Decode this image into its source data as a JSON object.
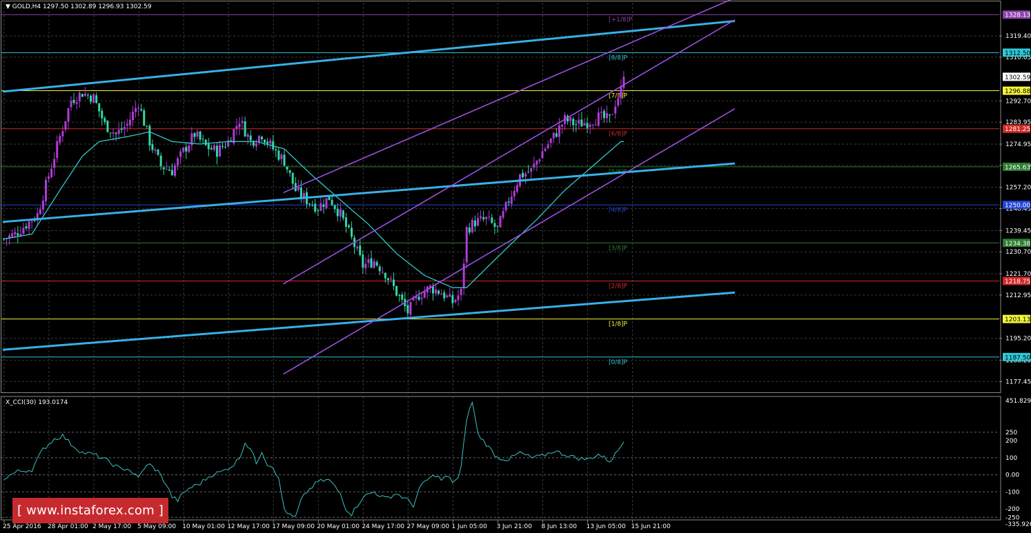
{
  "header": {
    "symbol": "GOLD,H4",
    "ohlc": "1297.50 1302.89 1296.93 1302.59",
    "indicator": "X_CCI(30) 193.0174"
  },
  "watermark": {
    "text": "[ www.instaforex.com ]"
  },
  "colors": {
    "bull": "#b13bd9",
    "bear": "#35d7a7",
    "ma": "#35c7c9",
    "channel": "#37b1e8",
    "purple": "#9b4fe0",
    "cci": "#3bc3c3"
  },
  "chart_data": [
    {
      "type": "line",
      "panel": "price",
      "ylim": [
        1173,
        1333
      ],
      "y_ticks": [
        "1319.40",
        "1310.65",
        "1292.70",
        "1283.95",
        "1274.95",
        "1266.20",
        "1257.20",
        "1248.45",
        "1239.45",
        "1230.70",
        "1221.70",
        "1212.95",
        "1195.20",
        "1186.20",
        "1177.45"
      ],
      "x_ticks": [
        "25 Apr 2016",
        "28 Apr 01:00",
        "2 May 17:00",
        "5 May 09:00",
        "10 May 01:00",
        "12 May 17:00",
        "17 May 09:00",
        "20 May 01:00",
        "24 May 17:00",
        "27 May 09:00",
        "1 Jun 05:00",
        "3 Jun 21:00",
        "8 Jun 13:00",
        "13 Jun 05:00",
        "15 Jun 21:00"
      ],
      "x_tick_bars": [
        0,
        16,
        32,
        48,
        64,
        80,
        96,
        112,
        128,
        144,
        160,
        176,
        192,
        208,
        224
      ],
      "price_labels": [
        {
          "text": "1328.13",
          "value": 1328.13,
          "bg": "#8e44ad",
          "fg": "#ffffff"
        },
        {
          "text": "1312.50",
          "value": 1312.5,
          "bg": "#2ec9d6",
          "fg": "#000000"
        },
        {
          "text": "1302.59",
          "value": 1302.59,
          "bg": "#ffffff",
          "fg": "#000000"
        },
        {
          "text": "1296.88",
          "value": 1296.88,
          "bg": "#f5f53a",
          "fg": "#000000"
        },
        {
          "text": "1281.25",
          "value": 1281.25,
          "bg": "#d12a2a",
          "fg": "#ffffff"
        },
        {
          "text": "1265.63",
          "value": 1265.63,
          "bg": "#2e7d32",
          "fg": "#ffffff"
        },
        {
          "text": "1250.00",
          "value": 1250.0,
          "bg": "#2446d8",
          "fg": "#ffffff"
        },
        {
          "text": "1234.38",
          "value": 1234.38,
          "bg": "#2e7d32",
          "fg": "#ffffff"
        },
        {
          "text": "1218.75",
          "value": 1218.75,
          "bg": "#d12a2a",
          "fg": "#ffffff"
        },
        {
          "text": "1203.13",
          "value": 1203.13,
          "bg": "#f5f53a",
          "fg": "#000000"
        },
        {
          "text": "1187.50",
          "value": 1187.5,
          "bg": "#2ec9d6",
          "fg": "#000000"
        }
      ],
      "murrey_levels": [
        {
          "label": "[+1/8]P",
          "value": 1328.13,
          "color": "#8e44ad"
        },
        {
          "label": "[8/8]P",
          "value": 1312.5,
          "color": "#2ec9d6"
        },
        {
          "label": "[7/8]P",
          "value": 1296.88,
          "color": "#f5f53a"
        },
        {
          "label": "[6/8]P",
          "value": 1281.25,
          "color": "#d12a2a"
        },
        {
          "label": "[5/8]P",
          "value": 1265.63,
          "color": "#2e7d32"
        },
        {
          "label": "[4/8]P",
          "value": 1250.0,
          "color": "#2446d8"
        },
        {
          "label": "[3/8]P",
          "value": 1234.38,
          "color": "#2e7d32"
        },
        {
          "label": "[2/8]P",
          "value": 1218.75,
          "color": "#d12a2a"
        },
        {
          "label": "[1/8]P",
          "value": 1203.13,
          "color": "#f5f53a"
        },
        {
          "label": "[0/8]P",
          "value": 1187.5,
          "color": "#2ec9d6"
        }
      ],
      "close_anchors": [
        [
          0,
          1236
        ],
        [
          4,
          1238
        ],
        [
          8,
          1242
        ],
        [
          12,
          1246
        ],
        [
          16,
          1262
        ],
        [
          20,
          1278
        ],
        [
          24,
          1293
        ],
        [
          28,
          1296
        ],
        [
          32,
          1294
        ],
        [
          36,
          1283
        ],
        [
          40,
          1279
        ],
        [
          44,
          1283
        ],
        [
          48,
          1292
        ],
        [
          52,
          1276
        ],
        [
          56,
          1266
        ],
        [
          60,
          1264
        ],
        [
          64,
          1272
        ],
        [
          68,
          1279
        ],
        [
          72,
          1274
        ],
        [
          76,
          1272
        ],
        [
          80,
          1276
        ],
        [
          84,
          1285
        ],
        [
          88,
          1276
        ],
        [
          92,
          1279
        ],
        [
          96,
          1273
        ],
        [
          100,
          1268
        ],
        [
          104,
          1256
        ],
        [
          108,
          1252
        ],
        [
          112,
          1249
        ],
        [
          116,
          1253
        ],
        [
          120,
          1246
        ],
        [
          124,
          1236
        ],
        [
          128,
          1225
        ],
        [
          132,
          1227
        ],
        [
          136,
          1222
        ],
        [
          140,
          1214
        ],
        [
          144,
          1206
        ],
        [
          148,
          1213
        ],
        [
          152,
          1216
        ],
        [
          156,
          1214
        ],
        [
          160,
          1210
        ],
        [
          163,
          1214
        ],
        [
          165,
          1240
        ],
        [
          168,
          1243
        ],
        [
          172,
          1244
        ],
        [
          176,
          1240
        ],
        [
          180,
          1252
        ],
        [
          184,
          1262
        ],
        [
          188,
          1264
        ],
        [
          192,
          1272
        ],
        [
          196,
          1278
        ],
        [
          200,
          1285
        ],
        [
          204,
          1283
        ],
        [
          208,
          1284
        ],
        [
          212,
          1286
        ],
        [
          216,
          1285
        ],
        [
          218,
          1292
        ],
        [
          220,
          1297
        ],
        [
          221,
          1302.6
        ]
      ],
      "ma_anchors": [
        [
          0,
          1236
        ],
        [
          10,
          1238
        ],
        [
          20,
          1256
        ],
        [
          28,
          1270
        ],
        [
          34,
          1276
        ],
        [
          44,
          1278
        ],
        [
          52,
          1280
        ],
        [
          60,
          1276
        ],
        [
          70,
          1275
        ],
        [
          80,
          1276
        ],
        [
          90,
          1276
        ],
        [
          100,
          1273
        ],
        [
          110,
          1262
        ],
        [
          120,
          1252
        ],
        [
          130,
          1242
        ],
        [
          140,
          1230
        ],
        [
          150,
          1221
        ],
        [
          160,
          1216
        ],
        [
          165,
          1216
        ],
        [
          172,
          1224
        ],
        [
          180,
          1233
        ],
        [
          190,
          1244
        ],
        [
          200,
          1256
        ],
        [
          210,
          1266
        ],
        [
          220,
          1276
        ]
      ],
      "channel_lines": [
        {
          "bar1": 0,
          "v1": 1296.5,
          "bar2": 261,
          "v2": 1325.5
        },
        {
          "bar1": 0,
          "v1": 1243.0,
          "bar2": 261,
          "v2": 1267.0
        },
        {
          "bar1": 0,
          "v1": 1190.5,
          "bar2": 261,
          "v2": 1214.0
        }
      ],
      "purple_lines": [
        {
          "bar1": 100,
          "v1": 1255.0,
          "bar2": 269,
          "v2": 1339.0
        },
        {
          "bar1": 100,
          "v1": 1217.5,
          "bar2": 261,
          "v2": 1326.0
        },
        {
          "bar1": 100,
          "v1": 1180.5,
          "bar2": 261,
          "v2": 1289.5
        }
      ]
    },
    {
      "type": "line",
      "panel": "indicator",
      "name": "X_CCI(30)",
      "ylim": [
        -265,
        460
      ],
      "y_ticks": [
        "451.8296",
        "250",
        "200",
        "100",
        "0.00",
        "-100",
        "-200",
        "-250",
        "-335.9269"
      ],
      "levels": [
        250,
        100,
        0,
        -100,
        -250
      ],
      "anchors": [
        [
          0,
          -20
        ],
        [
          5,
          20
        ],
        [
          10,
          30
        ],
        [
          14,
          150
        ],
        [
          18,
          210
        ],
        [
          21,
          230
        ],
        [
          24,
          180
        ],
        [
          28,
          130
        ],
        [
          32,
          120
        ],
        [
          36,
          90
        ],
        [
          40,
          50
        ],
        [
          42,
          30
        ],
        [
          44,
          40
        ],
        [
          48,
          -20
        ],
        [
          50,
          40
        ],
        [
          52,
          60
        ],
        [
          55,
          20
        ],
        [
          58,
          -60
        ],
        [
          60,
          -130
        ],
        [
          62,
          -150
        ],
        [
          64,
          -110
        ],
        [
          66,
          -80
        ],
        [
          70,
          -50
        ],
        [
          74,
          0
        ],
        [
          78,
          20
        ],
        [
          82,
          60
        ],
        [
          84,
          100
        ],
        [
          86,
          190
        ],
        [
          88,
          150
        ],
        [
          90,
          70
        ],
        [
          92,
          140
        ],
        [
          94,
          60
        ],
        [
          96,
          50
        ],
        [
          98,
          -30
        ],
        [
          100,
          -200
        ],
        [
          102,
          -240
        ],
        [
          104,
          -250
        ],
        [
          106,
          -150
        ],
        [
          108,
          -100
        ],
        [
          112,
          -40
        ],
        [
          116,
          -30
        ],
        [
          120,
          -110
        ],
        [
          122,
          -200
        ],
        [
          124,
          -230
        ],
        [
          128,
          -130
        ],
        [
          132,
          -100
        ],
        [
          136,
          -140
        ],
        [
          140,
          -110
        ],
        [
          144,
          -150
        ],
        [
          146,
          -180
        ],
        [
          148,
          -90
        ],
        [
          150,
          -40
        ],
        [
          152,
          -20
        ],
        [
          154,
          0
        ],
        [
          156,
          -30
        ],
        [
          158,
          -10
        ],
        [
          160,
          -40
        ],
        [
          162,
          -20
        ],
        [
          163,
          40
        ],
        [
          165,
          330
        ],
        [
          167,
          430
        ],
        [
          169,
          240
        ],
        [
          171,
          200
        ],
        [
          173,
          160
        ],
        [
          176,
          100
        ],
        [
          180,
          90
        ],
        [
          184,
          130
        ],
        [
          188,
          100
        ],
        [
          192,
          110
        ],
        [
          196,
          140
        ],
        [
          200,
          120
        ],
        [
          204,
          100
        ],
        [
          208,
          90
        ],
        [
          212,
          120
        ],
        [
          216,
          80
        ],
        [
          218,
          120
        ],
        [
          220,
          170
        ],
        [
          221,
          193
        ]
      ]
    }
  ]
}
